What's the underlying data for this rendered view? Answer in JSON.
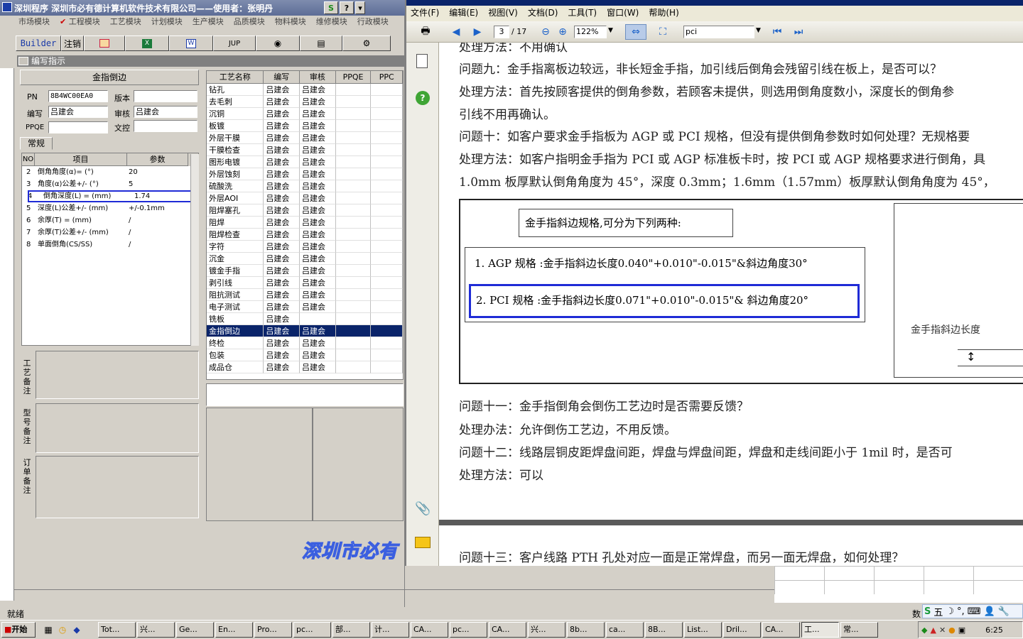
{
  "left_app": {
    "title": "深圳程序    深圳市必有德计算机软件技术有限公司——使用者：张明丹",
    "title_buttons": [
      "S",
      "?",
      "▾"
    ],
    "modules": [
      "市场模块",
      "工程模块",
      "工艺模块",
      "计划模块",
      "生产模块",
      "品质模块",
      "物料模块",
      "维修模块",
      "行政模块"
    ],
    "toolbar": [
      "Builder",
      "注销",
      "",
      "",
      "W",
      "JUP",
      "",
      "",
      ""
    ],
    "panel_title": "编写指示",
    "section_title": "金指倒边",
    "fields": {
      "pn_label": "PN",
      "pn_value": "8B4WC00EA0",
      "version_label": "版本",
      "version_value": "",
      "writer_label": "编写",
      "writer_value": "吕建会",
      "review_label": "审核",
      "review_value": "吕建会",
      "ppqe_label": "PPQE",
      "ppqe_value": "",
      "control_label": "文控",
      "control_value": ""
    },
    "tab_label": "常规",
    "param_headers": [
      "NO",
      "项目",
      "参数"
    ],
    "params": [
      {
        "no": "2",
        "item": "倒角角度(α)=  (°)",
        "val": "20"
      },
      {
        "no": "3",
        "item": "角度(α)公差+/-  (°)",
        "val": "5"
      },
      {
        "no": "4",
        "item": "倒角深度(L) =  (mm)",
        "val": "1.74"
      },
      {
        "no": "5",
        "item": "深度(L)公差+/-  (mm)",
        "val": "+/-0.1mm"
      },
      {
        "no": "6",
        "item": "余厚(T) =  (mm)",
        "val": "/"
      },
      {
        "no": "7",
        "item": "余厚(T)公差+/-  (mm)",
        "val": "/"
      },
      {
        "no": "8",
        "item": "单面倒角(CS/SS)",
        "val": "/"
      }
    ],
    "notes": [
      "工艺备注",
      "型号备注",
      "订单备注"
    ],
    "proc_headers": [
      "工艺名称",
      "编写",
      "审核",
      "PPQE",
      "PPC"
    ],
    "processes": [
      {
        "name": "钻孔",
        "w": "吕建会",
        "r": "吕建会"
      },
      {
        "name": "去毛刺",
        "w": "吕建会",
        "r": "吕建会"
      },
      {
        "name": "沉铜",
        "w": "吕建会",
        "r": "吕建会"
      },
      {
        "name": "板镀",
        "w": "吕建会",
        "r": "吕建会"
      },
      {
        "name": "外层干膜",
        "w": "吕建会",
        "r": "吕建会"
      },
      {
        "name": "干膜检查",
        "w": "吕建会",
        "r": "吕建会"
      },
      {
        "name": "图形电镀",
        "w": "吕建会",
        "r": "吕建会"
      },
      {
        "name": "外层蚀刻",
        "w": "吕建会",
        "r": "吕建会"
      },
      {
        "name": "硫酸洗",
        "w": "吕建会",
        "r": "吕建会"
      },
      {
        "name": "外层AOI",
        "w": "吕建会",
        "r": "吕建会"
      },
      {
        "name": "阻焊塞孔",
        "w": "吕建会",
        "r": "吕建会"
      },
      {
        "name": "阻焊",
        "w": "吕建会",
        "r": "吕建会"
      },
      {
        "name": "阻焊检查",
        "w": "吕建会",
        "r": "吕建会"
      },
      {
        "name": "字符",
        "w": "吕建会",
        "r": "吕建会"
      },
      {
        "name": "沉金",
        "w": "吕建会",
        "r": "吕建会"
      },
      {
        "name": "镀金手指",
        "w": "吕建会",
        "r": "吕建会"
      },
      {
        "name": "剥引线",
        "w": "吕建会",
        "r": "吕建会"
      },
      {
        "name": "阻抗测试",
        "w": "吕建会",
        "r": "吕建会"
      },
      {
        "name": "电子测试",
        "w": "吕建会",
        "r": "吕建会"
      },
      {
        "name": "铣板",
        "w": "吕建会",
        "r": ""
      },
      {
        "name": "金指倒边",
        "w": "吕建会",
        "r": "吕建会"
      },
      {
        "name": "终检",
        "w": "吕建会",
        "r": "吕建会"
      },
      {
        "name": "包装",
        "w": "吕建会",
        "r": "吕建会"
      },
      {
        "name": "成品仓",
        "w": "吕建会",
        "r": "吕建会"
      }
    ],
    "watermark": "深圳市必有"
  },
  "pdf": {
    "menu": [
      "文件(F)",
      "编辑(E)",
      "视图(V)",
      "文档(D)",
      "工具(T)",
      "窗口(W)",
      "帮助(H)"
    ],
    "page_current": "3",
    "page_total": "/ 17",
    "zoom": "122%",
    "search": "pci",
    "lines": [
      "处理方法：不用确认",
      "问题九：金手指离板边较远，非长短金手指，加引线后倒角会残留引线在板上，是否可以？",
      "处理方法：首先按顾客提供的倒角参数，若顾客未提供，则选用倒角度数小，深度长的倒角参",
      "引线不用再确认。",
      "问题十：如客户要求金手指板为 AGP 或 PCI 规格，但没有提供倒角参数时如何处理？无规格要",
      "处理方法：如客户指明金手指为 PCI 或 AGP 标准板卡时，按 PCI 或 AGP 规格要求进行倒角，具",
      "1.0mm 板厚默认倒角角度为 45°，深度 0.3mm；1.6mm（1.57mm）板厚默认倒角角度为 45°，"
    ],
    "figure": {
      "heading": "金手指斜边规格,可分为下列两种:",
      "agp": "1. AGP 规格 :金手指斜边长度0.040\"+0.010\"-0.015\"&斜边角度30°",
      "pci": "2.  PCI 规格 :金手指斜边长度0.071\"+0.010\"-0.015\"& 斜边角度20°",
      "side_label": "金手指斜边长度"
    },
    "lines2": [
      "问题十一：金手指倒角会倒伤工艺边时是否需要反馈？",
      "处理办法：允许倒伤工艺边，不用反馈。",
      "问题十二：线路层铜皮距焊盘间距，焊盘与焊盘间距，焊盘和走线间距小于 1mil 时，是否可",
      "处理方法：可以"
    ],
    "next_page_line": "问题十三：客户线路 PTH 孔处对应一面是正常焊盘，而另一面无焊盘，如何处理？"
  },
  "status": {
    "text": "就绪",
    "right": "数"
  },
  "taskbar": {
    "start": "开始",
    "tasks": [
      "Tot...",
      "兴...",
      "Ge...",
      "En...",
      "Pro...",
      "pc...",
      "部...",
      "计...",
      "CA...",
      "pc...",
      "CA...",
      "兴...",
      "8b...",
      "ca...",
      "8B...",
      "List...",
      "Dril...",
      "CA...",
      "工...",
      "常..."
    ],
    "clock": "6:25",
    "ime": "五"
  },
  "colors": {
    "highlight_box": "#1f2bd6",
    "selection": "#0a246a",
    "watermark": "#3b5fe0"
  }
}
